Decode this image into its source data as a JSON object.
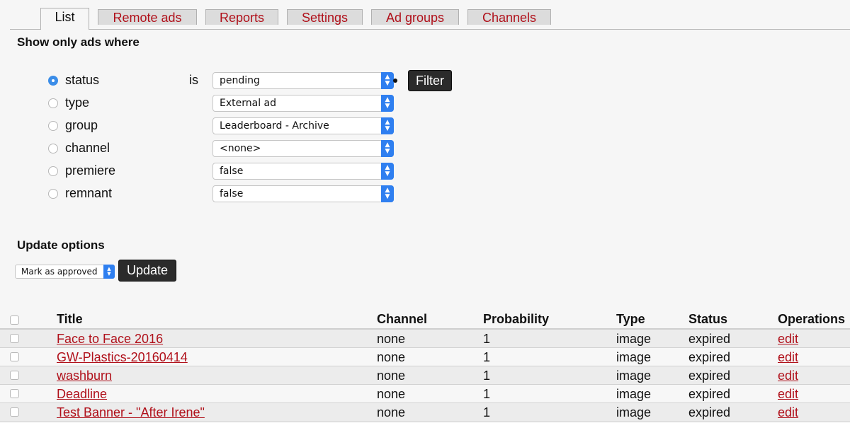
{
  "tabs": [
    {
      "label": "List",
      "active": true
    },
    {
      "label": "Remote ads"
    },
    {
      "label": "Reports"
    },
    {
      "label": "Settings"
    },
    {
      "label": "Ad groups"
    },
    {
      "label": "Channels"
    }
  ],
  "filter": {
    "heading": "Show only ads where",
    "operator": "is",
    "button": "Filter",
    "rows": [
      {
        "label": "status",
        "value": "pending",
        "selected": true
      },
      {
        "label": "type",
        "value": "External ad",
        "selected": false
      },
      {
        "label": "group",
        "value": "Leaderboard - Archive",
        "selected": false
      },
      {
        "label": "channel",
        "value": "<none>",
        "selected": false
      },
      {
        "label": "premiere",
        "value": "false",
        "selected": false
      },
      {
        "label": "remnant",
        "value": "false",
        "selected": false
      }
    ]
  },
  "update": {
    "heading": "Update options",
    "selected_option": "Mark as approved",
    "button": "Update"
  },
  "table": {
    "columns": [
      "Title",
      "Channel",
      "Probability",
      "Type",
      "Status",
      "Operations"
    ],
    "rows": [
      {
        "title": "Face to Face 2016",
        "channel": "none",
        "probability": "1",
        "type": "image",
        "status": "expired",
        "op": "edit"
      },
      {
        "title": "GW-Plastics-20160414",
        "channel": "none",
        "probability": "1",
        "type": "image",
        "status": "expired",
        "op": "edit"
      },
      {
        "title": "washburn",
        "channel": "none",
        "probability": "1",
        "type": "image",
        "status": "expired",
        "op": "edit"
      },
      {
        "title": "Deadline",
        "channel": "none",
        "probability": "1",
        "type": "image",
        "status": "expired",
        "op": "edit"
      },
      {
        "title": "Test Banner - \"After Irene\"",
        "channel": "none",
        "probability": "1",
        "type": "image",
        "status": "expired",
        "op": "edit"
      }
    ]
  },
  "colors": {
    "link": "#b0101a",
    "select_accent": "#2f7ff0",
    "button": "#2b2b2b"
  }
}
